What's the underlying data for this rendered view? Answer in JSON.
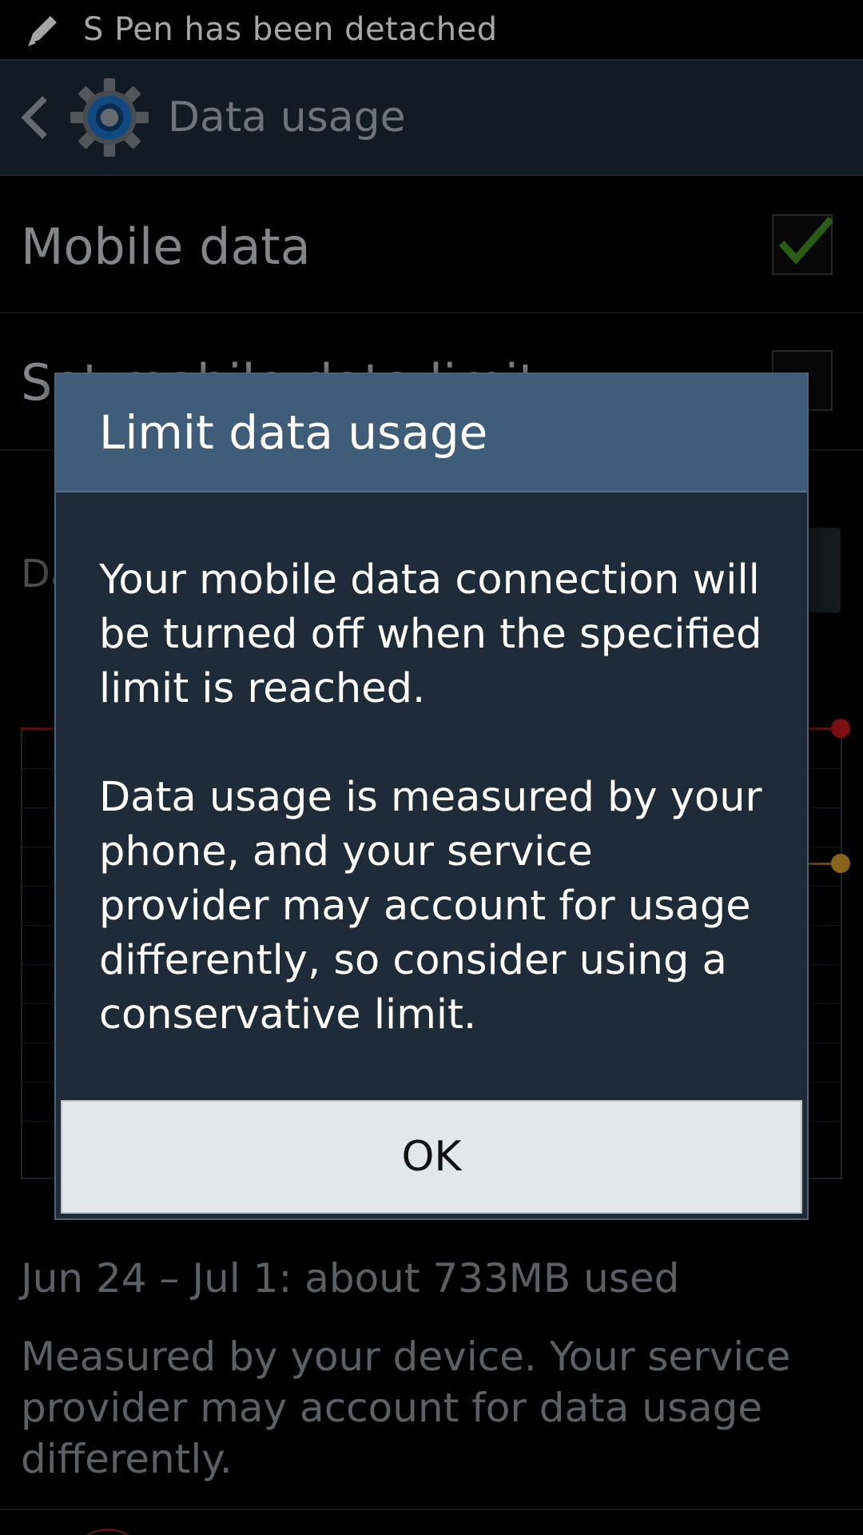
{
  "status_bar": {
    "icon": "pen-icon",
    "text": "S Pen has been detached"
  },
  "action_bar": {
    "back_icon": "back-chevron-icon",
    "app_icon": "gear-icon",
    "title": "Data usage"
  },
  "settings": {
    "mobile_data": {
      "label": "Mobile data",
      "checked": true
    },
    "set_limit": {
      "label": "Set mobile data limit",
      "checked": false
    },
    "cycle_label": "Da"
  },
  "summary": {
    "usage": "Jun 24 – Jul 1: about 733MB used",
    "note": "Measured by your device. Your service provider may account for data usage differently."
  },
  "dialog": {
    "title": "Limit data usage",
    "body_1": "Your mobile data connection will be turned off when the specified limit is reached.",
    "body_2": "Data usage is measured by your phone, and your service provider may account for usage differently, so consider using a conservative limit.",
    "ok_label": "OK"
  },
  "colors": {
    "limit_line": "#c0181e",
    "warning_line": "#d49a2a",
    "check": "#3f8f1e",
    "dialog_header": "#3f5c78"
  }
}
